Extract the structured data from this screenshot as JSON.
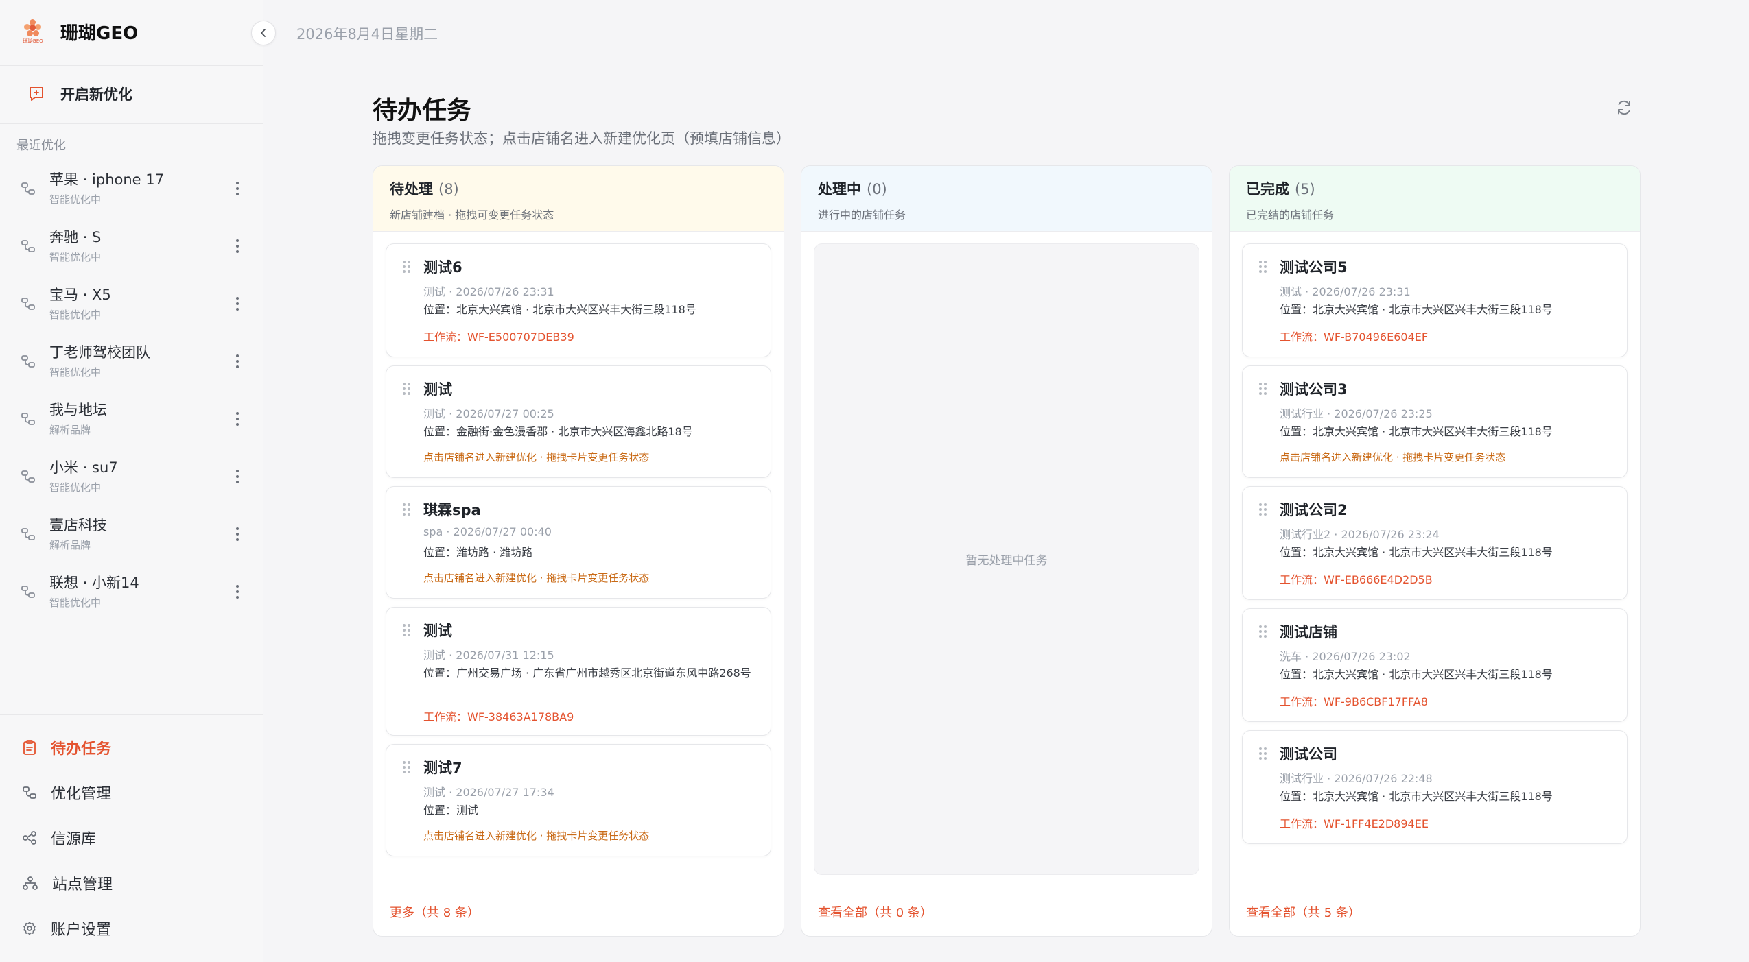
{
  "brand": {
    "name": "珊瑚GEO",
    "logo_text": "珊瑚GEO"
  },
  "header": {
    "date": "2026年8月4日星期二"
  },
  "sidebar": {
    "new_optimization": "开启新优化",
    "recent_title": "最近优化",
    "recent": [
      {
        "name": "苹果 · iphone 17",
        "status": "智能优化中"
      },
      {
        "name": "奔驰 · S",
        "status": "智能优化中"
      },
      {
        "name": "宝马 · X5",
        "status": "智能优化中"
      },
      {
        "name": "丁老师驾校团队",
        "status": "智能优化中"
      },
      {
        "name": "我与地坛",
        "status": "解析品牌"
      },
      {
        "name": "小米 · su7",
        "status": "智能优化中"
      },
      {
        "name": "壹店科技",
        "status": "解析品牌"
      },
      {
        "name": "联想 · 小新14",
        "status": "智能优化中"
      }
    ],
    "nav": [
      {
        "label": "待办任务",
        "icon": "clipboard-icon",
        "active": true
      },
      {
        "label": "优化管理",
        "icon": "link-nodes-icon",
        "active": false
      },
      {
        "label": "信源库",
        "icon": "share-icon",
        "active": false
      },
      {
        "label": "站点管理",
        "icon": "sitemap-icon",
        "active": false
      },
      {
        "label": "账户设置",
        "icon": "gear-icon",
        "active": false
      }
    ]
  },
  "main": {
    "title": "待办任务",
    "subtitle": "拖拽变更任务状态；点击店铺名进入新建优化页（预填店铺信息）",
    "columns": [
      {
        "title": "待处理",
        "count": "(8)",
        "subtitle": "新店铺建档 · 拖拽可变更任务状态",
        "footer": "更多（共 8 条）",
        "cards": [
          {
            "name": "测试6",
            "meta": "测试 · 2026/07/26 23:31",
            "location": "位置：北京大兴宾馆 · 北京市大兴区兴丰大街三段118号",
            "footer": "工作流：WF-E500707DEB39",
            "footer_type": "wf"
          },
          {
            "name": "测试",
            "meta": "测试 · 2026/07/27 00:25",
            "location": "位置：金融街·金色漫香郡 · 北京市大兴区海鑫北路18号",
            "footer": "点击店铺名进入新建优化 · 拖拽卡片变更任务状态",
            "footer_type": "hint"
          },
          {
            "name": "琪霖spa",
            "meta": "spa · 2026/07/27 00:40",
            "location": "位置：潍坊路 · 潍坊路",
            "footer": "点击店铺名进入新建优化 · 拖拽卡片变更任务状态",
            "footer_type": "hint"
          },
          {
            "name": "测试",
            "meta": "测试 · 2026/07/31 12:15",
            "location": "位置：广州交易广场 · 广东省广州市越秀区北京街道东风中路268号",
            "footer": "工作流：WF-38463A178BA9",
            "footer_type": "wf"
          },
          {
            "name": "测试7",
            "meta": "测试 · 2026/07/27 17:34",
            "location": "位置：测试",
            "footer": "点击店铺名进入新建优化 · 拖拽卡片变更任务状态",
            "footer_type": "hint"
          }
        ]
      },
      {
        "title": "处理中",
        "count": "(0)",
        "subtitle": "进行中的店铺任务",
        "footer": "查看全部（共 0 条）",
        "empty": "暂无处理中任务",
        "cards": []
      },
      {
        "title": "已完成",
        "count": "(5)",
        "subtitle": "已完结的店铺任务",
        "footer": "查看全部（共 5 条）",
        "cards": [
          {
            "name": "测试公司5",
            "meta": "测试 · 2026/07/26 23:31",
            "location": "位置：北京大兴宾馆 · 北京市大兴区兴丰大街三段118号",
            "footer": "工作流：WF-B70496E604EF",
            "footer_type": "wf"
          },
          {
            "name": "测试公司3",
            "meta": "测试行业 · 2026/07/26 23:25",
            "location": "位置：北京大兴宾馆 · 北京市大兴区兴丰大街三段118号",
            "footer": "点击店铺名进入新建优化 · 拖拽卡片变更任务状态",
            "footer_type": "hint"
          },
          {
            "name": "测试公司2",
            "meta": "测试行业2 · 2026/07/26 23:24",
            "location": "位置：北京大兴宾馆 · 北京市大兴区兴丰大街三段118号",
            "footer": "工作流：WF-EB666E4D2D5B",
            "footer_type": "wf"
          },
          {
            "name": "测试店铺",
            "meta": "洗车 · 2026/07/26 23:02",
            "location": "位置：北京大兴宾馆 · 北京市大兴区兴丰大街三段118号",
            "footer": "工作流：WF-9B6CBF17FFA8",
            "footer_type": "wf"
          },
          {
            "name": "测试公司",
            "meta": "测试行业 · 2026/07/26 22:48",
            "location": "位置：北京大兴宾馆 · 北京市大兴区兴丰大街三段118号",
            "footer": "工作流：WF-1FF4E2D894EE",
            "footer_type": "wf"
          }
        ]
      }
    ]
  },
  "colors": {
    "accent": "#e4532f",
    "hint": "#c96a16",
    "pending_head": "#fffaeb",
    "progress_head": "#f1f8fd",
    "done_head": "#eefbf3"
  }
}
